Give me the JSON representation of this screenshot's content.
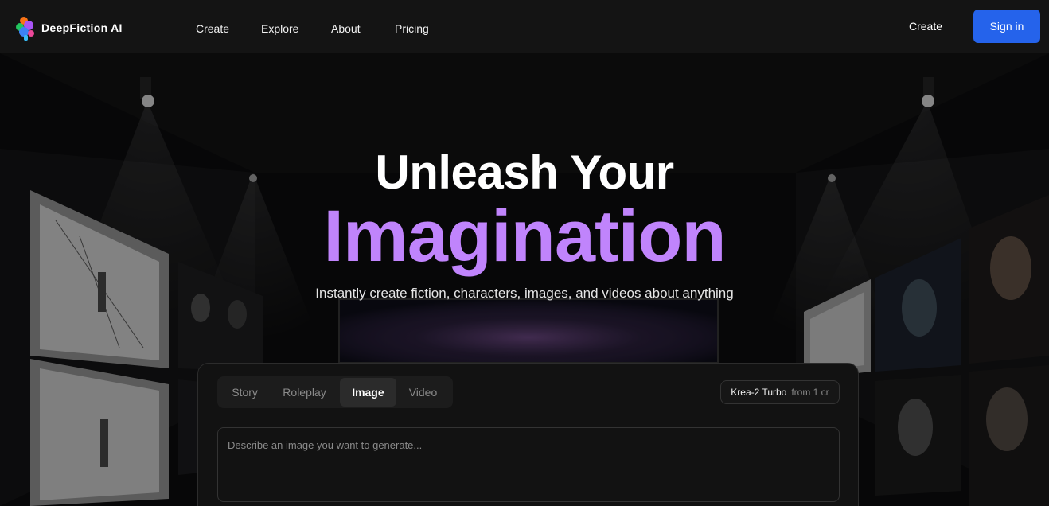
{
  "brand": {
    "name": "DeepFiction AI"
  },
  "nav": {
    "links": [
      "Create",
      "Explore",
      "About",
      "Pricing"
    ],
    "create_right": "Create",
    "signin": "Sign in"
  },
  "hero": {
    "title": "Unleash Your",
    "accent": "Imagination",
    "subtitle": "Instantly create fiction, characters, images, and videos about anything"
  },
  "generator": {
    "tabs": [
      {
        "label": "Story",
        "active": false
      },
      {
        "label": "Roleplay",
        "active": false
      },
      {
        "label": "Image",
        "active": true
      },
      {
        "label": "Video",
        "active": false
      }
    ],
    "model": {
      "name": "Krea-2 Turbo",
      "cost": "from 1 cr"
    },
    "prompt_placeholder": "Describe an image you want to generate..."
  },
  "colors": {
    "accent": "#c084fc",
    "primary": "#2563eb",
    "background": "#0b0b0c"
  }
}
